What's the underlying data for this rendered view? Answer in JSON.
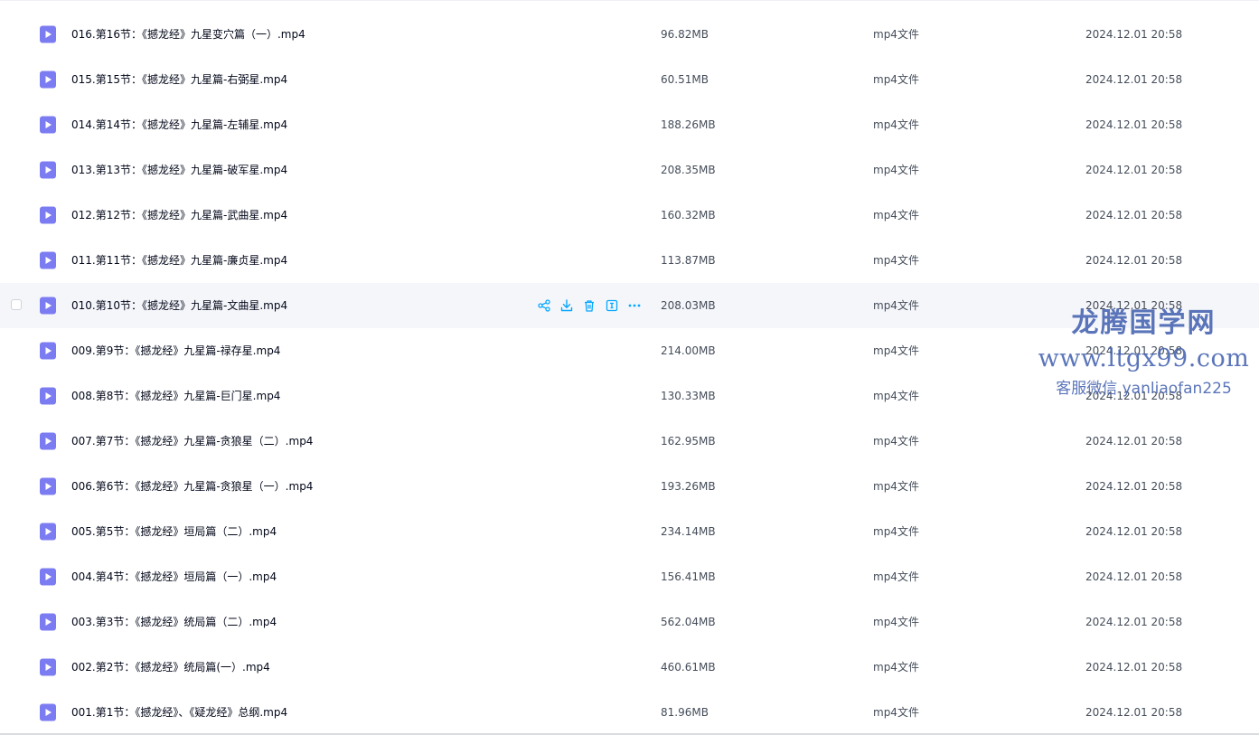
{
  "files": [
    {
      "name": "016.第16节：《撼龙经》九星变穴篇（一）.mp4",
      "size": "96.82MB",
      "type": "mp4文件",
      "date": "2024.12.01 20:58"
    },
    {
      "name": "015.第15节：《撼龙经》九星篇-右弼星.mp4",
      "size": "60.51MB",
      "type": "mp4文件",
      "date": "2024.12.01 20:58"
    },
    {
      "name": "014.第14节：《撼龙经》九星篇-左辅星.mp4",
      "size": "188.26MB",
      "type": "mp4文件",
      "date": "2024.12.01 20:58"
    },
    {
      "name": "013.第13节：《撼龙经》九星篇-破军星.mp4",
      "size": "208.35MB",
      "type": "mp4文件",
      "date": "2024.12.01 20:58"
    },
    {
      "name": "012.第12节：《撼龙经》九星篇-武曲星.mp4",
      "size": "160.32MB",
      "type": "mp4文件",
      "date": "2024.12.01 20:58"
    },
    {
      "name": "011.第11节：《撼龙经》九星篇-廉贞星.mp4",
      "size": "113.87MB",
      "type": "mp4文件",
      "date": "2024.12.01 20:58"
    },
    {
      "name": "010.第10节：《撼龙经》九星篇-文曲星.mp4",
      "size": "208.03MB",
      "type": "mp4文件",
      "date": "2024.12.01 20:58",
      "hovered": true
    },
    {
      "name": "009.第9节：《撼龙经》九星篇-禄存星.mp4",
      "size": "214.00MB",
      "type": "mp4文件",
      "date": "2024.12.01 20:58"
    },
    {
      "name": "008.第8节：《撼龙经》九星篇-巨门星.mp4",
      "size": "130.33MB",
      "type": "mp4文件",
      "date": "2024.12.01 20:58"
    },
    {
      "name": "007.第7节：《撼龙经》九星篇-贪狼星（二）.mp4",
      "size": "162.95MB",
      "type": "mp4文件",
      "date": "2024.12.01 20:58"
    },
    {
      "name": "006.第6节：《撼龙经》九星篇-贪狼星（一）.mp4",
      "size": "193.26MB",
      "type": "mp4文件",
      "date": "2024.12.01 20:58"
    },
    {
      "name": "005.第5节：《撼龙经》垣局篇（二）.mp4",
      "size": "234.14MB",
      "type": "mp4文件",
      "date": "2024.12.01 20:58"
    },
    {
      "name": "004.第4节：《撼龙经》垣局篇（一）.mp4",
      "size": "156.41MB",
      "type": "mp4文件",
      "date": "2024.12.01 20:58"
    },
    {
      "name": "003.第3节：《撼龙经》统局篇（二）.mp4",
      "size": "562.04MB",
      "type": "mp4文件",
      "date": "2024.12.01 20:58"
    },
    {
      "name": "002.第2节：《撼龙经》统局篇(一）.mp4",
      "size": "460.61MB",
      "type": "mp4文件",
      "date": "2024.12.01 20:58"
    },
    {
      "name": "001.第1节：《撼龙经》、《疑龙经》总纲.mp4",
      "size": "81.96MB",
      "type": "mp4文件",
      "date": "2024.12.01 20:58"
    }
  ],
  "row_actions": [
    "share-icon",
    "download-icon",
    "delete-icon",
    "rename-icon",
    "more-icon"
  ],
  "watermark": {
    "line1": "龙腾国学网",
    "line2": "www.ltgx99.com",
    "line3": "客服微信 yanliaofan225"
  },
  "colors": {
    "icon_purple": "#7c7cf2",
    "action_blue": "#06a7ff",
    "hover_bg": "#f5f6fa",
    "watermark": "#4462b0"
  }
}
